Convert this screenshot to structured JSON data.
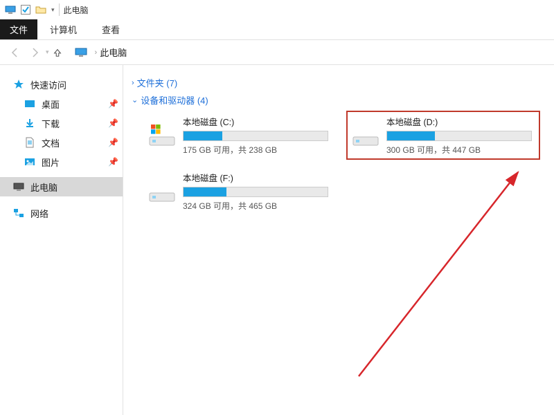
{
  "window_title": "此电脑",
  "ribbon": {
    "file": "文件",
    "tabs": [
      "计算机",
      "查看"
    ]
  },
  "address": {
    "location": "此电脑"
  },
  "sidebar": {
    "quick_access": "快速访问",
    "items": [
      {
        "label": "桌面",
        "icon": "desktop"
      },
      {
        "label": "下载",
        "icon": "downloads"
      },
      {
        "label": "文档",
        "icon": "documents"
      },
      {
        "label": "图片",
        "icon": "pictures"
      }
    ],
    "this_pc": "此电脑",
    "network": "网络"
  },
  "main": {
    "folders_header": "文件夹 (7)",
    "devices_header": "设备和驱动器 (4)",
    "drives": [
      {
        "name": "本地磁盘 (C:)",
        "free": "175 GB 可用，共 238 GB",
        "fill_pct": 27,
        "os": true
      },
      {
        "name": "本地磁盘 (D:)",
        "free": "300 GB 可用，共 447 GB",
        "fill_pct": 33,
        "highlight": true
      },
      {
        "name": "本地磁盘 (F:)",
        "free": "324 GB 可用，共 465 GB",
        "fill_pct": 30
      }
    ]
  }
}
